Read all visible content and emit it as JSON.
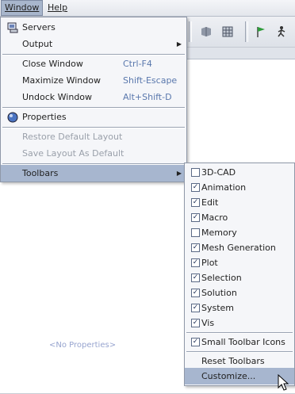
{
  "menubar": {
    "window": "Window",
    "help": "Help"
  },
  "window_menu": {
    "items": [
      {
        "label": "Servers",
        "icon": "servers-icon"
      },
      {
        "label": "Output",
        "submenu": true
      },
      {
        "label": "Close Window",
        "accel": "Ctrl-F4"
      },
      {
        "label": "Maximize Window",
        "accel": "Shift-Escape"
      },
      {
        "label": "Undock Window",
        "accel": "Alt+Shift-D"
      },
      {
        "label": "Properties",
        "icon": "properties-icon"
      },
      {
        "label": "Restore Default Layout",
        "disabled": true
      },
      {
        "label": "Save Layout As Default",
        "disabled": true
      },
      {
        "label": "Toolbars",
        "submenu": true,
        "selected": true
      }
    ]
  },
  "toolbars_menu": {
    "items": [
      {
        "label": "3D-CAD",
        "checked": false
      },
      {
        "label": "Animation",
        "checked": true
      },
      {
        "label": "Edit",
        "checked": true
      },
      {
        "label": "Macro",
        "checked": true
      },
      {
        "label": "Memory",
        "checked": false
      },
      {
        "label": "Mesh Generation",
        "checked": true
      },
      {
        "label": "Plot",
        "checked": true
      },
      {
        "label": "Selection",
        "checked": true
      },
      {
        "label": "Solution",
        "checked": true
      },
      {
        "label": "System",
        "checked": true
      },
      {
        "label": "Vis",
        "checked": true
      },
      {
        "label": "Small Toolbar Icons",
        "checked": true
      },
      {
        "label": "Reset Toolbars"
      },
      {
        "label": "Customize..."
      }
    ]
  },
  "properties_panel": {
    "empty_text": "<No Properties>"
  },
  "colors": {
    "menu_bg": "#f5f6f9",
    "selection": "#a7b6cf",
    "accel": "#5a78ad",
    "disabled": "#9aa0aa"
  }
}
